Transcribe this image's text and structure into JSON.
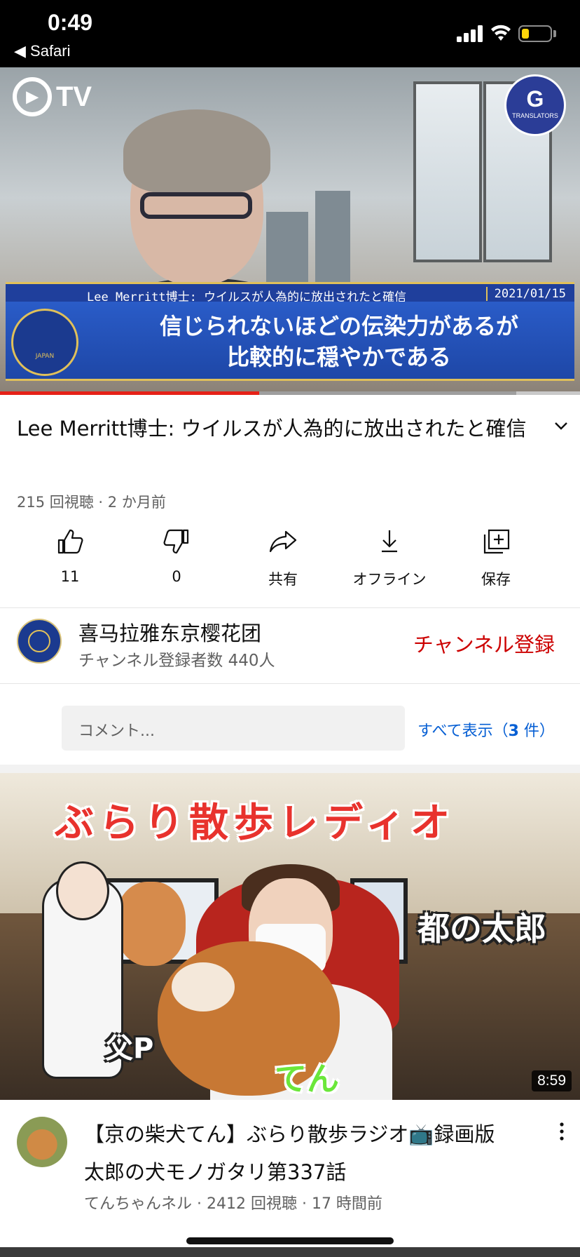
{
  "status_bar": {
    "time": "0:49",
    "back_app": "◀ Safari",
    "battery_color": "#ffd60a"
  },
  "player": {
    "logo_text": "TV",
    "badge_text": "G",
    "badge_sub": "TRANSLATORS",
    "caption_headline": "Lee Merritt博士: ウイルスが人為的に放出されたと確信",
    "caption_date": "2021/01/15",
    "caption_line1": "信じられないほどの伝染力があるが",
    "caption_line2": "比較的に穏やかである",
    "seal_text": "JAPAN",
    "progress_played": 0.447,
    "progress_buffered_end": 0.89
  },
  "video": {
    "title": "Lee Merritt博士: ウイルスが人為的に放出されたと確信",
    "meta": "215 回視聴 · 2 か月前"
  },
  "actions": [
    {
      "icon": "thumbs-up-icon",
      "label": "11"
    },
    {
      "icon": "thumbs-down-icon",
      "label": "0"
    },
    {
      "icon": "share-icon",
      "label": "共有"
    },
    {
      "icon": "download-icon",
      "label": "オフライン"
    },
    {
      "icon": "save-playlist-icon",
      "label": "保存"
    }
  ],
  "channel": {
    "name": "喜马拉雅东京樱花团",
    "subscribers": "チャンネル登録者数 440人",
    "subscribe_label": "チャンネル登録",
    "subscribe_color": "#cc0000"
  },
  "comments": {
    "placeholder": "コメント...",
    "show_all": "すべて表示（",
    "count": "3",
    "count_suffix": " 件）"
  },
  "next_video": {
    "thumb_title": "ぶらり散歩レディオ",
    "thumb_label_taro": "都の太郎",
    "thumb_label_dad": "父P",
    "thumb_label_ten": "てん",
    "duration": "8:59",
    "title": "【京の柴犬てん】ぶらり散歩ラジオ📺録画版　太郎の犬モノガタリ第337話",
    "meta": "てんちゃんネル · 2412 回視聴 · 17 時間前"
  }
}
